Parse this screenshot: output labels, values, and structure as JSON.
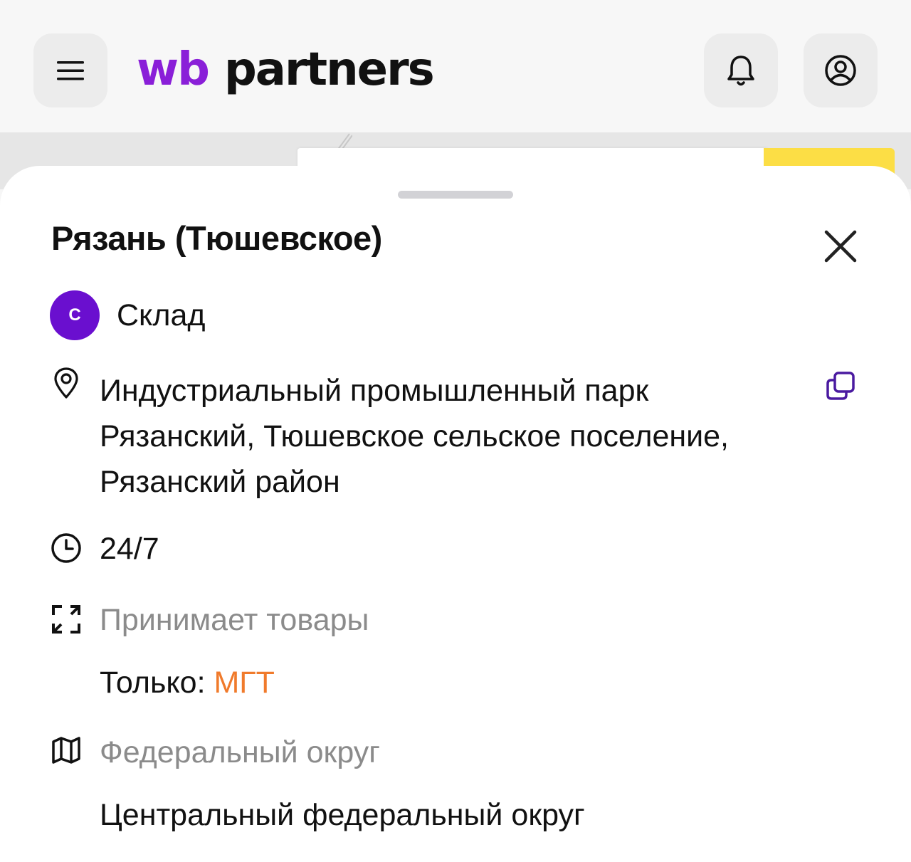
{
  "header": {
    "logo_wb": "wb",
    "logo_partners": "partners",
    "menu_icon": "hamburger-menu-icon",
    "bell_icon": "bell-icon",
    "profile_icon": "user-profile-icon"
  },
  "sheet": {
    "title": "Рязань (Тюшевское)",
    "type_badge": "С",
    "type_label": "Склад",
    "address": "Индустриальный промышленный парк Рязанский, Тюшевское сельское поселение, Рязанский район",
    "hours": "24/7",
    "accepts_label": "Принимает товары",
    "only_prefix": "Только:",
    "only_value": "МГТ",
    "district_label": "Федеральный округ",
    "district_value": "Центральный федеральный округ"
  },
  "colors": {
    "brand_purple": "#8a1fd8",
    "badge_purple": "#6a0fcf",
    "accent_orange": "#f07a2b",
    "muted_text": "#8b8b8b"
  }
}
